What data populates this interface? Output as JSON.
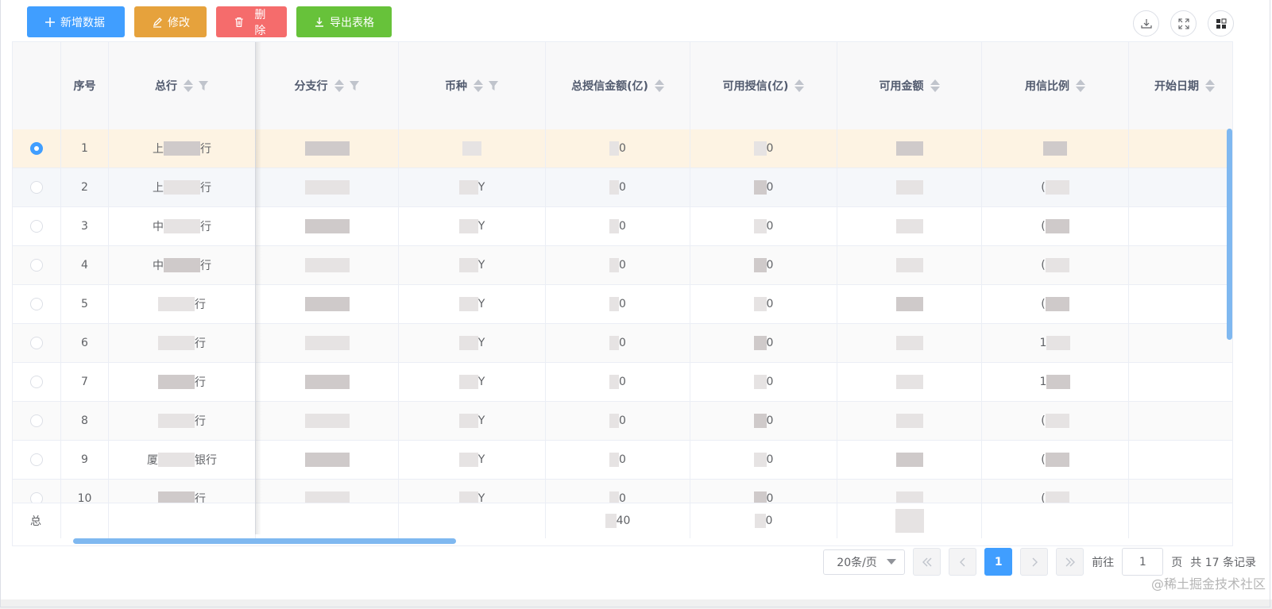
{
  "toolbar": {
    "add_label": "新增数据",
    "edit_label": "修改",
    "delete_label": "删除",
    "export_label": "导出表格"
  },
  "top_actions": [
    "download-icon",
    "fullscreen-icon",
    "layout-icon"
  ],
  "table": {
    "headers": {
      "index": "序号",
      "head_bank": "总行",
      "branch": "分支行",
      "currency": "币种",
      "total_credit": "总授信金额(亿)",
      "available_credit": "可用授信(亿)",
      "available_amount": "可用金额",
      "usage_ratio": "用信比例",
      "start_date": "开始日期"
    },
    "rows": [
      {
        "index": "1",
        "head_bank": "上",
        "head_bank_tail": "行",
        "currency": "",
        "total": "0",
        "avail": "0",
        "ratio": ""
      },
      {
        "index": "2",
        "head_bank": "上",
        "head_bank_tail": "行",
        "currency": "Y",
        "total": "0",
        "avail": "0",
        "ratio": "("
      },
      {
        "index": "3",
        "head_bank": "中",
        "head_bank_tail": "行",
        "currency": "Y",
        "total": "0",
        "avail": "0",
        "ratio": "("
      },
      {
        "index": "4",
        "head_bank": "中",
        "head_bank_tail": "行",
        "currency": "Y",
        "total": "0",
        "avail": "0",
        "ratio": "("
      },
      {
        "index": "5",
        "head_bank": "",
        "head_bank_tail": "行",
        "currency": "Y",
        "total": "0",
        "avail": "0",
        "ratio": "("
      },
      {
        "index": "6",
        "head_bank": "",
        "head_bank_tail": "行",
        "currency": "Y",
        "total": "0",
        "avail": "0",
        "ratio": "1"
      },
      {
        "index": "7",
        "head_bank": "",
        "head_bank_tail": "行",
        "currency": "Y",
        "total": "0",
        "avail": "0",
        "ratio": "1"
      },
      {
        "index": "8",
        "head_bank": "",
        "head_bank_tail": "行",
        "currency": "Y",
        "total": "0",
        "avail": "0",
        "ratio": "("
      },
      {
        "index": "9",
        "head_bank": "厦",
        "head_bank_tail": "银行",
        "currency": "Y",
        "total": "0",
        "avail": "0",
        "ratio": "("
      },
      {
        "index": "10",
        "head_bank": "",
        "head_bank_tail": "行",
        "currency": "Y",
        "total": "0",
        "avail": "0",
        "ratio": "("
      }
    ],
    "selected_row": 1,
    "summary": {
      "label": "总",
      "total": "40",
      "avail": "0"
    }
  },
  "pagination": {
    "page_size": "20条/页",
    "current_page": "1",
    "goto_prefix": "前往",
    "goto_value": "1",
    "goto_suffix": "页",
    "total_text": "共 17 条记录"
  },
  "watermark": "@稀土掘金技术社区"
}
